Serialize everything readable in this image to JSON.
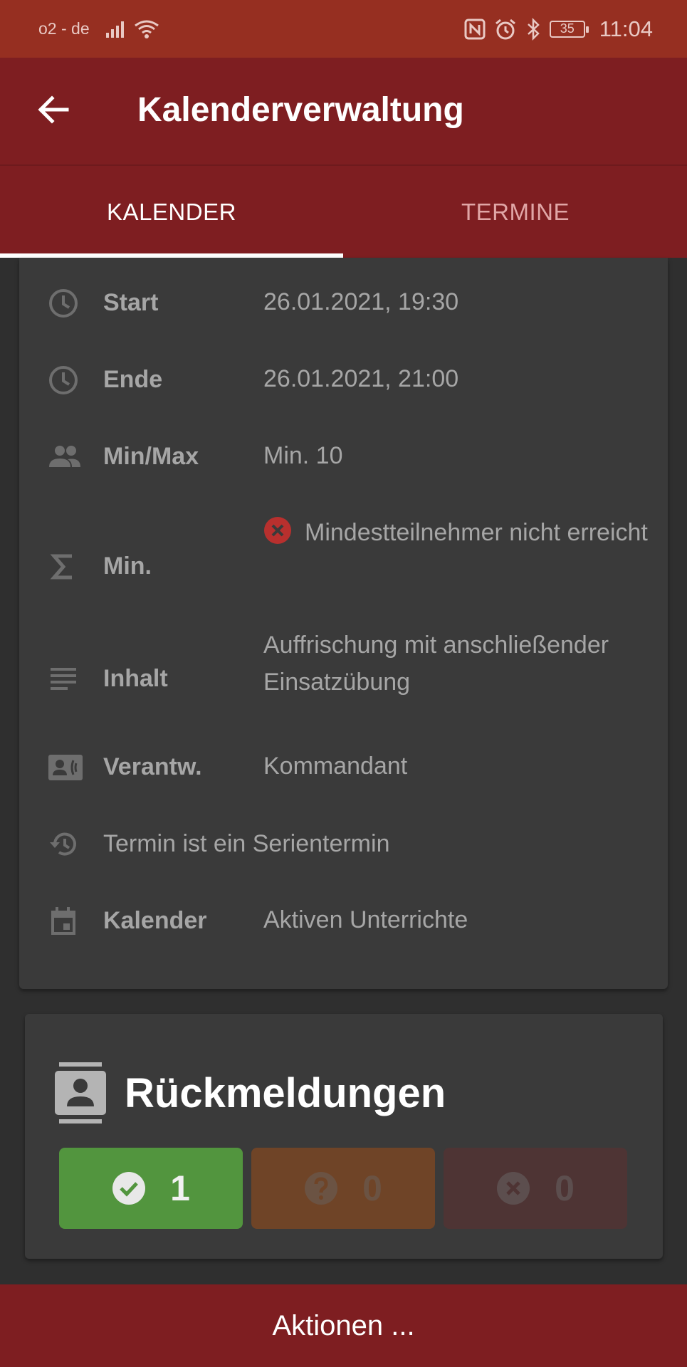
{
  "status": {
    "carrier": "o2 - de",
    "battery": "35",
    "time": "11:04"
  },
  "appbar": {
    "title": "Kalenderverwaltung"
  },
  "tabs": [
    {
      "label": "KALENDER",
      "active": true
    },
    {
      "label": "TERMINE",
      "active": false
    }
  ],
  "details": {
    "start": {
      "label": "Start",
      "value": "26.01.2021, 19:30",
      "icon": "clock-icon"
    },
    "end": {
      "label": "Ende",
      "value": "26.01.2021, 21:00",
      "icon": "clock-icon"
    },
    "minmax": {
      "label": "Min/Max",
      "value": "Min. 10",
      "icon": "people-icon"
    },
    "min": {
      "label": "Min.",
      "value": "Mindestteilnehmer nicht erreicht",
      "icon": "sigma-icon",
      "status_icon": "error-circle-icon"
    },
    "content": {
      "label": "Inhalt",
      "value": "Auffrischung mit anschließender Einsatzübung",
      "icon": "notes-icon"
    },
    "responsible": {
      "label": "Verantw.",
      "value": "Kommandant",
      "icon": "contact-card-icon"
    },
    "series": {
      "text": "Termin ist ein Serientermin",
      "icon": "history-icon"
    },
    "calendar": {
      "label": "Kalender",
      "value": "Aktiven Unterrichte",
      "icon": "calendar-icon"
    }
  },
  "responses": {
    "heading": "Rückmeldungen",
    "yes": 1,
    "maybe": 0,
    "no": 0
  },
  "colors": {
    "primary": "#7e1e21",
    "statusbar": "#962f21",
    "yes": "#52953e",
    "maybe": "#6f4427",
    "no": "#4e3434"
  },
  "bottom": {
    "action_label": "Aktionen ..."
  }
}
